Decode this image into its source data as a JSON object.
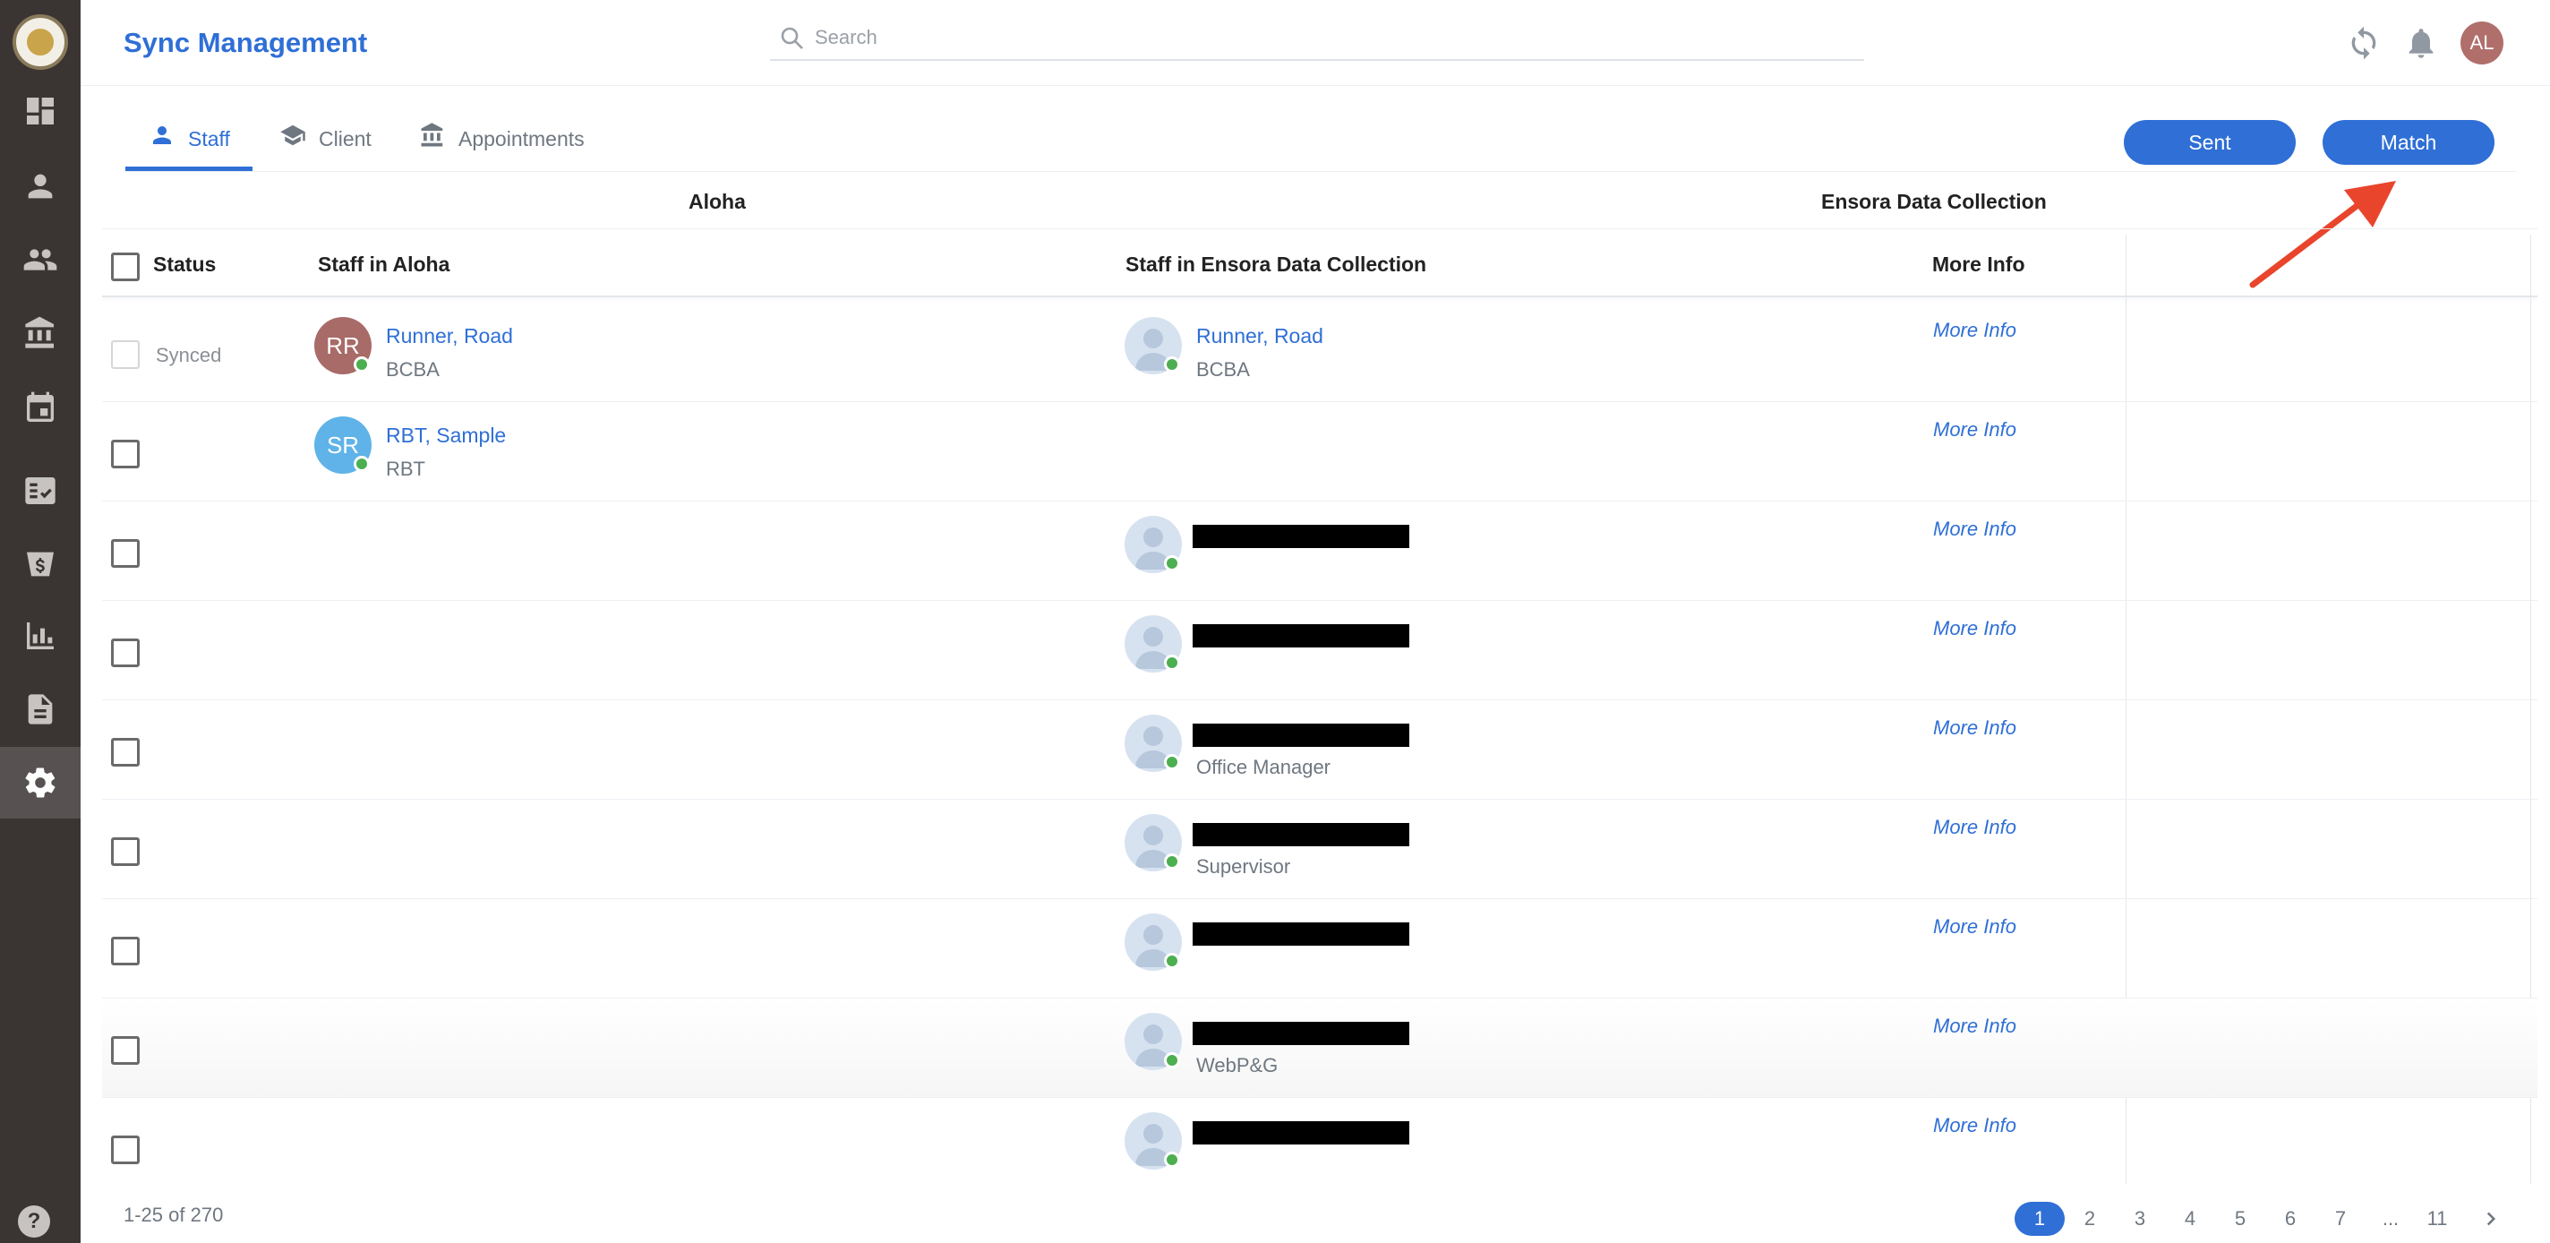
{
  "header": {
    "title": "Sync Management",
    "search_placeholder": "Search",
    "user_initials": "AL"
  },
  "tabs": [
    {
      "label": "Staff",
      "icon": "person-icon",
      "active": true
    },
    {
      "label": "Client",
      "icon": "graduation-cap-icon",
      "active": false
    },
    {
      "label": "Appointments",
      "icon": "bank-icon",
      "active": false
    }
  ],
  "actions": {
    "sent_label": "Sent",
    "match_label": "Match"
  },
  "table": {
    "group_left": "Aloha",
    "group_right": "Ensora Data Collection",
    "columns": {
      "status": "Status",
      "staff_aloha": "Staff in Aloha",
      "staff_ensora": "Staff in Ensora Data Collection",
      "more_info": "More Info"
    },
    "rows": [
      {
        "status": "Synced",
        "aloha_initials": "RR",
        "aloha_name": "Runner, Road",
        "aloha_role": "BCBA",
        "ensora_name": "Runner, Road",
        "ensora_role": "BCBA",
        "more_info": "More Info"
      },
      {
        "status": "",
        "aloha_initials": "SR",
        "aloha_name": "RBT, Sample",
        "aloha_role": "RBT",
        "ensora_name": "",
        "ensora_role": "",
        "more_info": "More Info"
      },
      {
        "status": "",
        "ensora_role": "",
        "more_info": "More Info"
      },
      {
        "status": "",
        "ensora_role": "",
        "more_info": "More Info"
      },
      {
        "status": "",
        "ensora_role": "Office Manager",
        "more_info": "More Info"
      },
      {
        "status": "",
        "ensora_role": "Supervisor",
        "more_info": "More Info"
      },
      {
        "status": "",
        "ensora_role": "",
        "more_info": "More Info"
      },
      {
        "status": "",
        "ensora_role": "WebP&G",
        "more_info": "More Info"
      },
      {
        "status": "",
        "ensora_role": "",
        "more_info": "More Info"
      }
    ]
  },
  "pagination": {
    "range_text": "1-25 of 270",
    "pages": [
      "1",
      "2",
      "3",
      "4",
      "5",
      "6",
      "7",
      "...",
      "11"
    ],
    "current": "1",
    "next_icon": "chevron-right-icon"
  },
  "colors": {
    "accent": "#2f6fd6",
    "sidebar": "#3a3533",
    "online": "#4caf50",
    "avatar_rr": "#a86b68",
    "avatar_sr": "#5fb3e8",
    "annotation_arrow": "#e8452c"
  },
  "sidebar_icons": [
    "logo",
    "dashboard-icon",
    "person-icon",
    "people-icon",
    "bank-icon",
    "calendar-icon",
    "billing-icon",
    "payment-icon",
    "reports-chart-icon",
    "document-icon",
    "settings-gear-icon",
    "help-icon"
  ]
}
